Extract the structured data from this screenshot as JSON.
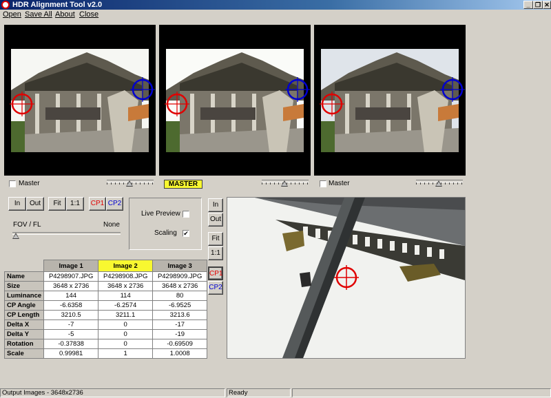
{
  "window": {
    "title": "HDR Alignment Tool  v2.0",
    "controls": [
      "_",
      "❐",
      "✕"
    ]
  },
  "menu": [
    "Open",
    "Save All",
    "About",
    "Close"
  ],
  "thumbnails": [
    {
      "master_label": "Master",
      "is_master": false,
      "sky": "#f6f7f3"
    },
    {
      "master_badge": "MASTER",
      "is_master": true,
      "sky": "#fafbf8"
    },
    {
      "master_label": "Master",
      "is_master": false,
      "sky": "#dfe4ea"
    }
  ],
  "zoom_buttons": {
    "in": "In",
    "out": "Out",
    "fit": "Fit",
    "one_to_one": "1:1",
    "cp1": "CP1",
    "cp2": "CP2"
  },
  "fov": {
    "label": "FOV / FL",
    "value": "None"
  },
  "options": {
    "live_preview_label": "Live Preview",
    "live_preview_checked": false,
    "scaling_label": "Scaling",
    "scaling_checked": true
  },
  "side_buttons": {
    "in": "In",
    "out": "Out",
    "fit": "Fit",
    "one_to_one": "1:1",
    "cp1": "CP1",
    "cp2": "CP2"
  },
  "table": {
    "headers": [
      "",
      "Image 1",
      "Image 2",
      "Image 3"
    ],
    "rows": [
      {
        "label": "Name",
        "values": [
          "P4298907.JPG",
          "P4298908.JPG",
          "P4298909.JPG"
        ]
      },
      {
        "label": "Size",
        "values": [
          "3648 x 2736",
          "3648 x 2736",
          "3648 x 2736"
        ]
      },
      {
        "label": "Luminance",
        "values": [
          "144",
          "114",
          "80"
        ]
      },
      {
        "label": "CP Angle",
        "values": [
          "-6.6358",
          "-6.2574",
          "-6.9525"
        ]
      },
      {
        "label": "CP Length",
        "values": [
          "3210.5",
          "3211.1",
          "3213.6"
        ]
      },
      {
        "label": "Delta X",
        "values": [
          "-7",
          "0",
          "-17"
        ]
      },
      {
        "label": "Delta Y",
        "values": [
          "-5",
          "0",
          "-19"
        ]
      },
      {
        "label": "Rotation",
        "values": [
          "-0.37838",
          "0",
          "-0.69509"
        ]
      },
      {
        "label": "Scale",
        "values": [
          "0.99981",
          "1",
          "1.0008"
        ]
      }
    ]
  },
  "status": {
    "output": "Output Images - 3648x2736",
    "state": "Ready"
  },
  "colors": {
    "cp1": "#e00000",
    "cp2": "#0000d0",
    "master_badge": "#f8f830",
    "highlight_header": "#f8f830"
  }
}
